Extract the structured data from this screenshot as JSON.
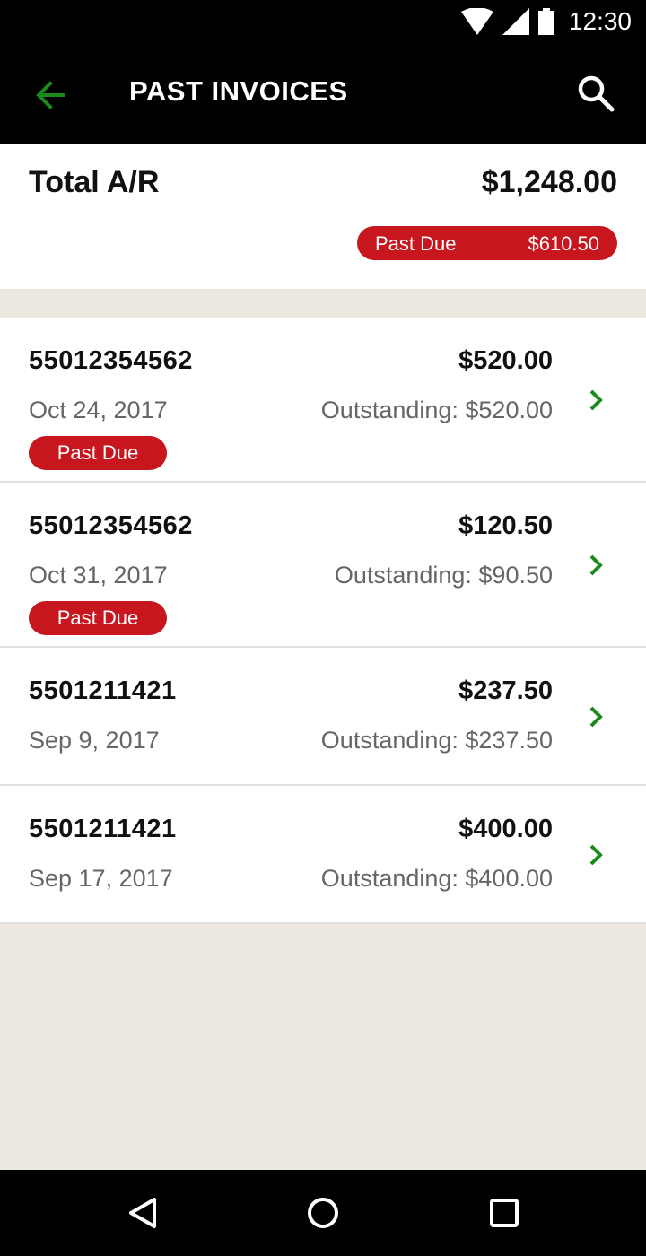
{
  "status_bar": {
    "time": "12:30",
    "icons": [
      "wifi-icon",
      "signal-icon",
      "battery-icon"
    ]
  },
  "app_bar": {
    "title": "PAST INVOICES",
    "back_icon": "arrow-left-icon",
    "search_icon": "search-icon"
  },
  "summary": {
    "label": "Total A/R",
    "total": "$1,248.00",
    "past_due_label": "Past Due",
    "past_due_amount": "$610.50"
  },
  "invoices": [
    {
      "number": "55012354562",
      "amount": "$520.00",
      "date": "Oct 24, 2017",
      "outstanding": "Outstanding: $520.00",
      "badge": "Past Due"
    },
    {
      "number": "55012354562",
      "amount": "$120.50",
      "date": "Oct 31, 2017",
      "outstanding": "Outstanding: $90.50",
      "badge": "Past Due"
    },
    {
      "number": "5501211421",
      "amount": "$237.50",
      "date": "Sep 9, 2017",
      "outstanding": "Outstanding: $237.50"
    },
    {
      "number": "5501211421",
      "amount": "$400.00",
      "date": "Sep 17, 2017",
      "outstanding": "Outstanding: $400.00"
    }
  ],
  "colors": {
    "accent_green": "#1a8a1a",
    "past_due_red": "#c8161e",
    "background": "#ece8df"
  },
  "nav_bar": {
    "icons": [
      "back-triangle-icon",
      "home-circle-icon",
      "recents-square-icon"
    ]
  }
}
